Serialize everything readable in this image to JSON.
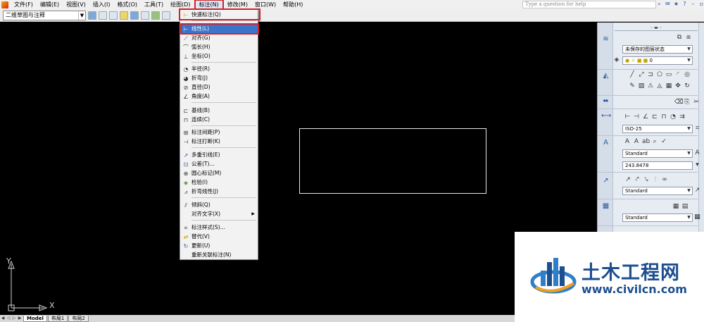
{
  "menubar": {
    "items": [
      "文件(F)",
      "编辑(E)",
      "视图(V)",
      "插入(I)",
      "格式(O)",
      "工具(T)",
      "绘图(D)",
      "标注(N)",
      "修改(M)",
      "窗口(W)",
      "帮助(H)"
    ],
    "active_index": 7,
    "help_placeholder": "Type a question for help"
  },
  "toolbar": {
    "workspace": "二维草图与注释"
  },
  "dimension_menu": {
    "items": [
      {
        "label": "快速标注(Q)",
        "icon": "quick-dimension-icon",
        "glyph": "⊢"
      },
      {
        "label": "线性(L)",
        "icon": "linear-dimension-icon",
        "glyph": "⊢",
        "selected": true
      },
      {
        "label": "对齐(G)",
        "icon": "aligned-dimension-icon",
        "glyph": "⟋"
      },
      {
        "label": "弧长(H)",
        "icon": "arc-length-icon",
        "glyph": "⌒"
      },
      {
        "label": "坐标(O)",
        "icon": "ordinate-icon",
        "glyph": "⊥"
      },
      {
        "label": "半径(R)",
        "icon": "radius-icon",
        "glyph": "◔"
      },
      {
        "label": "折弯(J)",
        "icon": "jogged-icon",
        "glyph": "◕"
      },
      {
        "label": "直径(D)",
        "icon": "diameter-icon",
        "glyph": "⊘"
      },
      {
        "label": "角度(A)",
        "icon": "angle-icon",
        "glyph": "∠"
      },
      {
        "label": "基线(B)",
        "icon": "baseline-icon",
        "glyph": "⊏"
      },
      {
        "label": "连续(C)",
        "icon": "continue-icon",
        "glyph": "⊓"
      },
      {
        "label": "标注间距(P)",
        "icon": "dim-space-icon",
        "glyph": "⊞"
      },
      {
        "label": "标注打断(K)",
        "icon": "dim-break-icon",
        "glyph": "⊣"
      },
      {
        "label": "多重引线(E)",
        "icon": "multileader-icon",
        "glyph": "↗"
      },
      {
        "label": "公差(T)...",
        "icon": "tolerance-icon",
        "glyph": "⊡"
      },
      {
        "label": "圆心标记(M)",
        "icon": "center-mark-icon",
        "glyph": "⊕"
      },
      {
        "label": "检验(I)",
        "icon": "inspect-icon",
        "glyph": "◈"
      },
      {
        "label": "折弯线性(J)",
        "icon": "jogged-linear-icon",
        "glyph": "⩘"
      },
      {
        "label": "倾斜(Q)",
        "icon": "oblique-icon",
        "glyph": "⫽"
      },
      {
        "label": "对齐文字(X)",
        "icon": "align-text-icon",
        "glyph": "",
        "submenu": true
      },
      {
        "label": "标注样式(S)...",
        "icon": "dim-style-icon",
        "glyph": "⌗"
      },
      {
        "label": "替代(V)",
        "icon": "override-icon",
        "glyph": "⇄"
      },
      {
        "label": "更新(U)",
        "icon": "update-icon",
        "glyph": "↻"
      },
      {
        "label": "重新关联标注(N)",
        "icon": "",
        "glyph": ""
      }
    ]
  },
  "palette": {
    "layer_state": "未保存的图层状态",
    "layer_current": "0",
    "dim_style": "ISO-25",
    "text_style": "Standard",
    "text_height": "243.8478",
    "mleader_style": "Standard",
    "table_style": "Standard"
  },
  "canvas": {
    "ucs_x": "X",
    "ucs_y": "Y"
  },
  "tabs": [
    "Model",
    "布局1",
    "布局2"
  ],
  "watermark": {
    "title": "土木工程网",
    "url": "www.civilcn.com"
  },
  "colors": {
    "highlight": "#d3212a",
    "selected": "#3c74c9",
    "brand": "#1d4e8f"
  }
}
